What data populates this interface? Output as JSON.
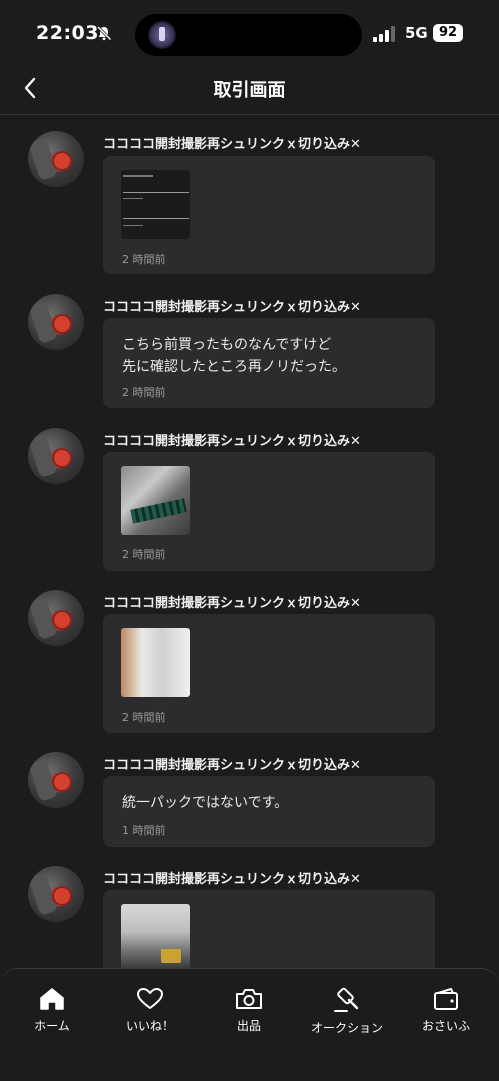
{
  "status_bar": {
    "time": "22:03",
    "network": "5G",
    "battery": "92"
  },
  "header": {
    "title": "取引画面"
  },
  "messages": [
    {
      "sender": "ココココ開封撮影再シュリンクｘ切り込み✕",
      "type": "image",
      "image": "screenshot-thumbnail",
      "time": "2 時間前"
    },
    {
      "sender": "ココココ開封撮影再シュリンクｘ切り込み✕",
      "type": "text",
      "text": "こちら前買ったものなんですけど\n先に確認したところ再ノリだった。",
      "time": "2 時間前"
    },
    {
      "sender": "ココココ開封撮影再シュリンクｘ切り込み✕",
      "type": "image",
      "image": "photo-thumbnail",
      "time": "2 時間前"
    },
    {
      "sender": "ココココ開封撮影再シュリンクｘ切り込み✕",
      "type": "image",
      "image": "photo-thumbnail",
      "time": "2 時間前"
    },
    {
      "sender": "ココココ開封撮影再シュリンクｘ切り込み✕",
      "type": "text",
      "text": "統一パックではないです。",
      "time": "1 時間前"
    },
    {
      "sender": "ココココ開封撮影再シュリンクｘ切り込み✕",
      "type": "image",
      "image": "photo-thumbnail",
      "time": ""
    }
  ],
  "tabbar": {
    "items": [
      {
        "label": "ホーム",
        "icon": "home-icon"
      },
      {
        "label": "いいね！",
        "icon": "heart-icon"
      },
      {
        "label": "出品",
        "icon": "camera-icon"
      },
      {
        "label": "オークション",
        "icon": "gavel-icon"
      },
      {
        "label": "おさいふ",
        "icon": "wallet-icon"
      }
    ]
  },
  "colors": {
    "background": "#1c1c1e",
    "bubble": "#2c2c2e",
    "text": "#eaeaea",
    "muted": "#9a9a9a"
  }
}
